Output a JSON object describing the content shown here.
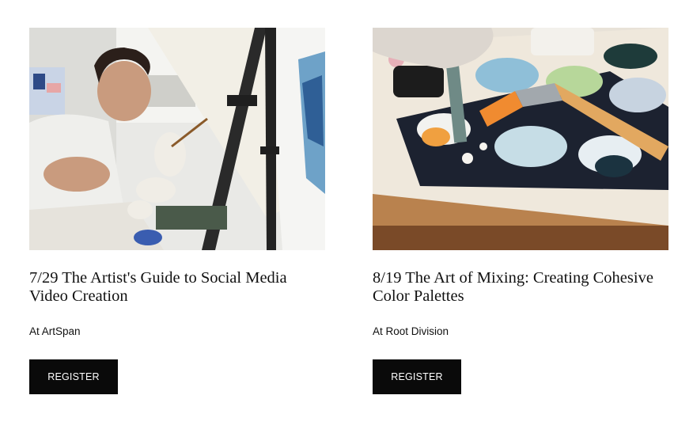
{
  "events": [
    {
      "title": "7/29 The Artist's Guide to Social Media Video Creation",
      "venue": "At ArtSpan",
      "button_label": "REGISTER",
      "image": "artist-painting-at-easel-photo"
    },
    {
      "title": "8/19 The Art of Mixing: Creating Cohesive Color Palettes",
      "venue": "At Root Division",
      "button_label": "REGISTER",
      "image": "paint-palette-and-brushes-photo"
    }
  ],
  "colors": {
    "button_bg": "#0a0a0a",
    "button_text": "#ffffff",
    "page_bg": "#ffffff"
  }
}
